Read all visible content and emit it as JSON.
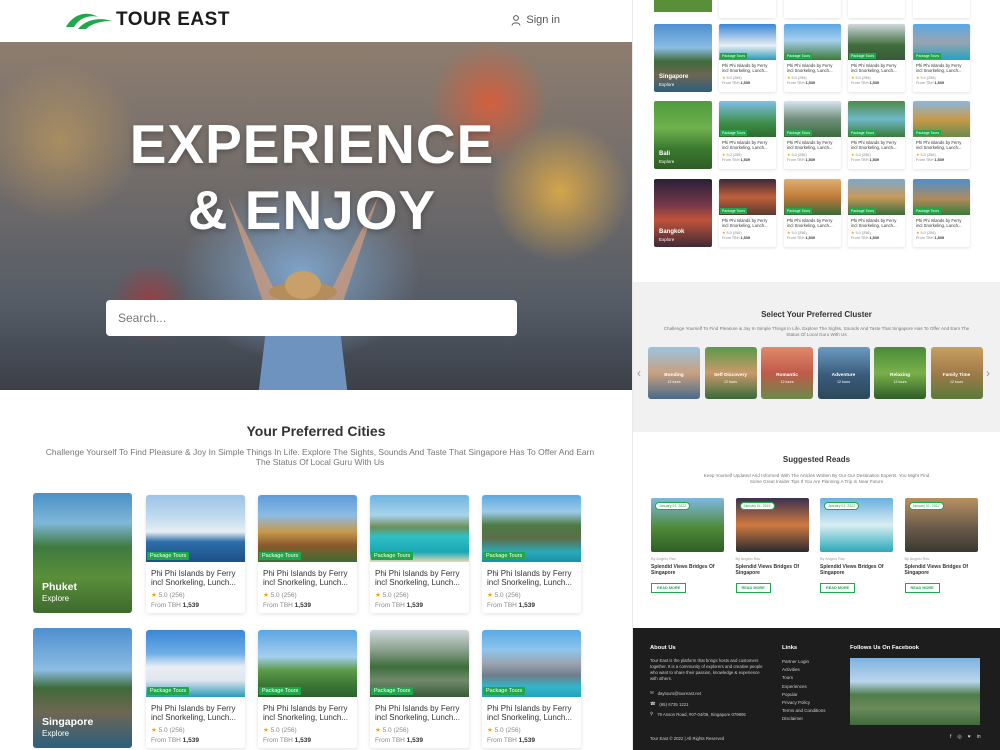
{
  "header": {
    "brand": "TOUR EAST",
    "signin": "Sign in"
  },
  "hero": {
    "title_line1": "EXPERIENCE",
    "title_line2": "& ENJOY",
    "search_placeholder": "Search..."
  },
  "cities": {
    "title": "Your Preferred Cities",
    "subtitle": "Challenge Yourself To Find Pleasure & Joy In Simple Things In Life. Explore The Sights, Sounds And Taste That Singapore Has To Offer And Earn The Status Of Local Guru With Us",
    "rows": [
      {
        "city": "Phuket",
        "explore": "Explore"
      },
      {
        "city": "Singapore",
        "explore": "Explore"
      }
    ],
    "card": {
      "badge": "Package Tours",
      "title_line1": "Phi Phi Islands by Ferry",
      "title_line2": "incl Snorkeling, Lunch...",
      "rating": "5.0 (256)",
      "price_prefix": "From TBH",
      "price": "1,539"
    }
  },
  "right": {
    "cities": [
      {
        "city": "Singapore",
        "explore": "Explore"
      },
      {
        "city": "Bali",
        "explore": "Explore"
      },
      {
        "city": "Bangkok",
        "explore": "Explore"
      }
    ],
    "card": {
      "badge": "Package Tours",
      "title_line1": "Phi Phi Islands by Ferry",
      "title_line2": "incl Snorkeling, Lunch...",
      "rating": "5.0 (256)",
      "price_prefix": "From TBH",
      "price": "1,539"
    },
    "clusters": {
      "title": "Select Your Preferred Cluster",
      "subtitle": "Challenge Yourself To Find Pleasure & Joy In Simple Things In Life. Explore The Sights, Sounds And Taste That Singapore Has To Offer And Earn The Status Of Local Guru With Us",
      "items": [
        {
          "name": "Bonding",
          "count": "12 tours"
        },
        {
          "name": "Self Discovery",
          "count": "12 tours"
        },
        {
          "name": "Romantic",
          "count": "12 tours"
        },
        {
          "name": "Adventure",
          "count": "12 tours"
        },
        {
          "name": "Relaxing",
          "count": "12 tours"
        },
        {
          "name": "Family Time",
          "count": "12 tours"
        }
      ]
    },
    "reads": {
      "title": "Suggested Reads",
      "subtitle": "Keep Yourself Updated And Informed With The Articles Written By Our Our Destination Experts. You Might Find Some Great Insider Tips If You Are Planning A Trip In Near Future",
      "items": [
        {
          "date": "January 01, 2022",
          "by": "By Angelo Rav",
          "title": "Splendid Views Bridges Of Singapore",
          "more": "READ MORE"
        },
        {
          "date": "January 01, 2022",
          "by": "By Angelo Rav",
          "title": "Splendid Views Bridges Of Singapore",
          "more": "READ MORE"
        },
        {
          "date": "January 01, 2022",
          "by": "By Angelo Rav",
          "title": "Splendid Views Bridges Of Singapore",
          "more": "READ MORE"
        },
        {
          "date": "January 01, 2022",
          "by": "By Angelo Rav",
          "title": "Splendid Views Bridges Of Singapore",
          "more": "READ MORE"
        }
      ]
    },
    "footer": {
      "about_title": "About Us",
      "about_text": "Tour East is the platform that brings hosts and customers together. It is a community of explorers and creative people who want to share their passion, knowledge & experience with others.",
      "email": "daytours@toureast.net",
      "phone": "(65) 6735 1221",
      "address": "79 Anson Road, #07-04/05, Singapore 079906",
      "links_title": "Links",
      "links": [
        "Partner Login",
        "Activities",
        "Tours",
        "Experiences",
        "Popular",
        "Privacy Policy",
        "Terms and Conditions",
        "Disclaimer"
      ],
      "facebook_title": "Follows Us On Facebook",
      "copyright": "Tour East © 2022 | All Rights Reserved"
    }
  }
}
